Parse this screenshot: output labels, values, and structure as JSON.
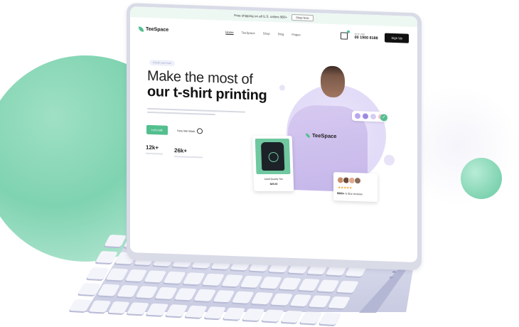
{
  "announcement": {
    "text": "Free shipping on all U.S. orders $50+",
    "shop_label": "Shop Now"
  },
  "brand": {
    "name": "TeeSpace"
  },
  "nav": {
    "items": [
      "Home",
      "TeeSpace",
      "Shop",
      "Blog",
      "Pages"
    ],
    "phone_label": "HOTLINE",
    "phone": "00 1900 8188",
    "signup_label": "Sign Up"
  },
  "hero": {
    "tag": "Check your now",
    "title_line1": "Make the most of",
    "title_line2": "our t-shirt printing",
    "primary_button": "Let's talk",
    "secondary_button": "How We Work",
    "stat1": "12k+",
    "stat2": "26k+",
    "hoodie_text": "TeeSpace"
  },
  "product_card": {
    "name": "Adult Quality Tee",
    "price": "$25.00"
  },
  "review_card": {
    "stars": "★★★★★",
    "count": "5000+",
    "label": "5 Star reviews"
  },
  "colors": {
    "accent": "#52bf8e",
    "swatches": [
      "#b9a6ef",
      "#9d8ae0",
      "#d6cdf5",
      "#f0c3d6"
    ],
    "avatars": [
      "#c88e6a",
      "#6b4a3a",
      "#e0a98c",
      "#8a6b5a"
    ]
  },
  "icons": [
    "leaf-logo-icon",
    "cart-icon",
    "play-icon",
    "check-icon",
    "star-icon"
  ]
}
